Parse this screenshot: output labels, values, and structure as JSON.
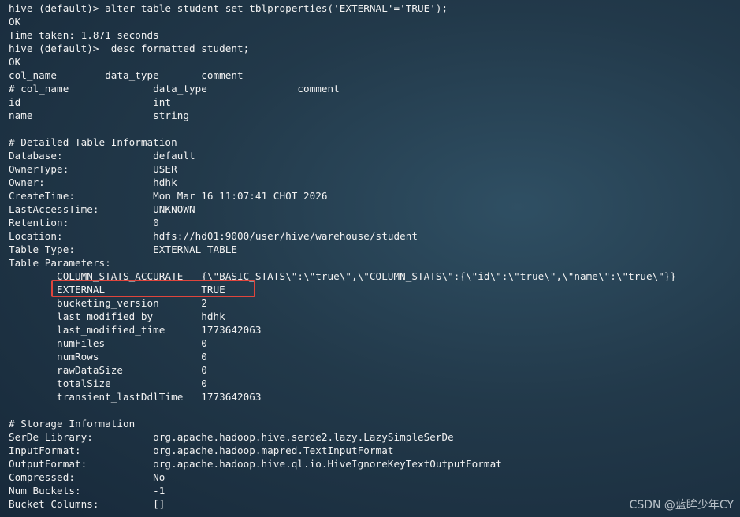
{
  "terminal": {
    "lines": [
      "hive (default)> alter table student set tblproperties('EXTERNAL'='TRUE');",
      "OK",
      "Time taken: 1.871 seconds",
      "hive (default)>  desc formatted student;",
      "OK",
      "col_name        data_type       comment",
      "# col_name              data_type               comment",
      "id                      int",
      "name                    string",
      "",
      "# Detailed Table Information",
      "Database:               default",
      "OwnerType:              USER",
      "Owner:                  hdhk",
      "CreateTime:             Mon Mar 16 11:07:41 CHOT 2026",
      "LastAccessTime:         UNKNOWN",
      "Retention:              0",
      "Location:               hdfs://hd01:9000/user/hive/warehouse/student",
      "Table Type:             EXTERNAL_TABLE",
      "Table Parameters:",
      "        COLUMN_STATS_ACCURATE   {\\\"BASIC_STATS\\\":\\\"true\\\",\\\"COLUMN_STATS\\\":{\\\"id\\\":\\\"true\\\",\\\"name\\\":\\\"true\\\"}}",
      "        EXTERNAL                TRUE",
      "        bucketing_version       2",
      "        last_modified_by        hdhk",
      "        last_modified_time      1773642063",
      "        numFiles                0",
      "        numRows                 0",
      "        rawDataSize             0",
      "        totalSize               0",
      "        transient_lastDdlTime   1773642063",
      "",
      "# Storage Information",
      "SerDe Library:          org.apache.hadoop.hive.serde2.lazy.LazySimpleSerDe",
      "InputFormat:            org.apache.hadoop.mapred.TextInputFormat",
      "OutputFormat:           org.apache.hadoop.hive.ql.io.HiveIgnoreKeyTextOutputFormat",
      "Compressed:             No",
      "Num Buckets:            -1",
      "Bucket Columns:         []"
    ],
    "highlight_color": "#e0453c"
  },
  "watermark": "CSDN @蓝眸少年CY"
}
